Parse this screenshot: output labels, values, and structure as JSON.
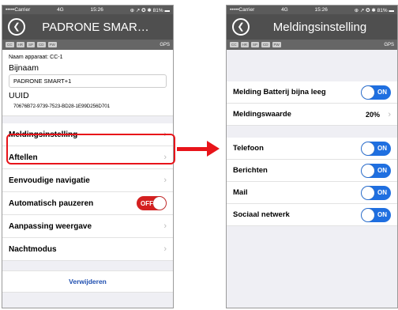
{
  "status": {
    "carrier": "•••••Carrier",
    "network": "4G",
    "time": "15:26",
    "right": "⊕ ↗ ✪ ✱ 81% ▬"
  },
  "sensors": {
    "chips": [
      "CC",
      "HR",
      "SP",
      "CD",
      "PW"
    ],
    "gps": "GPS"
  },
  "left": {
    "title": "PADRONE SMAR…",
    "device_label": "Naam apparaat:",
    "device_name": "CC-1",
    "nickname_label": "Bijnaam",
    "nickname_value": "PADRONE SMART+1",
    "uuid_label": "UUID",
    "uuid_value": "70676B72-9739-7523-BD28-1E99D256D701",
    "rows": [
      {
        "label": "Meldingsinstelling",
        "type": "chevron"
      },
      {
        "label": "Aftellen",
        "type": "chevron"
      },
      {
        "label": "Eenvoudige navigatie",
        "type": "chevron"
      },
      {
        "label": "Automatisch pauzeren",
        "type": "toggle",
        "toggle": "OFF"
      },
      {
        "label": "Aanpassing weergave",
        "type": "chevron"
      },
      {
        "label": "Nachtmodus",
        "type": "chevron"
      }
    ],
    "delete_label": "Verwijderen"
  },
  "right": {
    "title": "Meldingsinstelling",
    "battery_label": "Melding Batterij bijna leeg",
    "battery_toggle": "ON",
    "threshold_label": "Meldingswaarde",
    "threshold_value": "20%",
    "items": [
      {
        "label": "Telefoon",
        "toggle": "ON"
      },
      {
        "label": "Berichten",
        "toggle": "ON"
      },
      {
        "label": "Mail",
        "toggle": "ON"
      },
      {
        "label": "Sociaal netwerk",
        "toggle": "ON"
      }
    ]
  },
  "colors": {
    "highlight": "#e8141a",
    "toggle_on": "#1f6fe0",
    "toggle_off": "#d42020",
    "navbar": "#4f4f4f"
  }
}
